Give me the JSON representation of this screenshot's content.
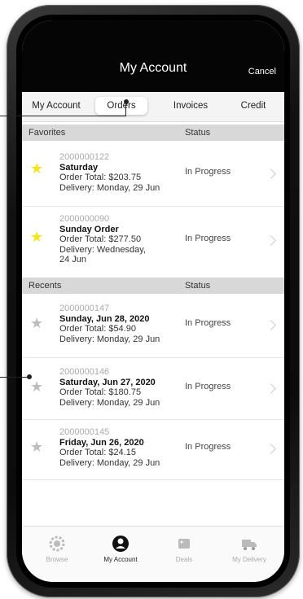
{
  "header": {
    "title": "My Account",
    "cancel_label": "Cancel"
  },
  "tabs": [
    "My Account",
    "Orders",
    "Invoices",
    "Credit"
  ],
  "active_tab": "Orders",
  "favorites": {
    "label": "Favorites",
    "status_label": "Status",
    "orders": [
      {
        "number": "2000000122",
        "title": "Saturday",
        "total": "Order Total: $203.75",
        "delivery": "Delivery: Monday, 29 Jun",
        "status": "In Progress"
      },
      {
        "number": "2000000090",
        "title": "Sunday Order",
        "total": "Order Total: $277.50",
        "delivery": "Delivery: Wednesday,",
        "delivery2": "24 Jun",
        "status": "In Progress"
      }
    ]
  },
  "recents": {
    "label": "Recents",
    "status_label": "Status",
    "orders": [
      {
        "number": "2000000147",
        "title": "Sunday, Jun 28, 2020",
        "total": "Order Total: $54.90",
        "delivery": "Delivery: Monday, 29 Jun",
        "status": "In Progress"
      },
      {
        "number": "2000000146",
        "title": "Saturday, Jun 27, 2020",
        "total": "Order Total: $180.75",
        "delivery": "Delivery: Monday, 29 Jun",
        "status": "In Progress"
      },
      {
        "number": "2000000145",
        "title": "Friday, Jun 26, 2020",
        "total": "Order Total: $24.15",
        "delivery": "Delivery: Monday, 29 Jun",
        "status": "In Progress"
      }
    ]
  },
  "bottom_nav": [
    "Browse",
    "My Account",
    "Deals",
    "My Delivery"
  ],
  "colors": {
    "favorite_star": "#f2e51a",
    "recent_star": "#bdbdbd",
    "navbar": "#050505"
  }
}
